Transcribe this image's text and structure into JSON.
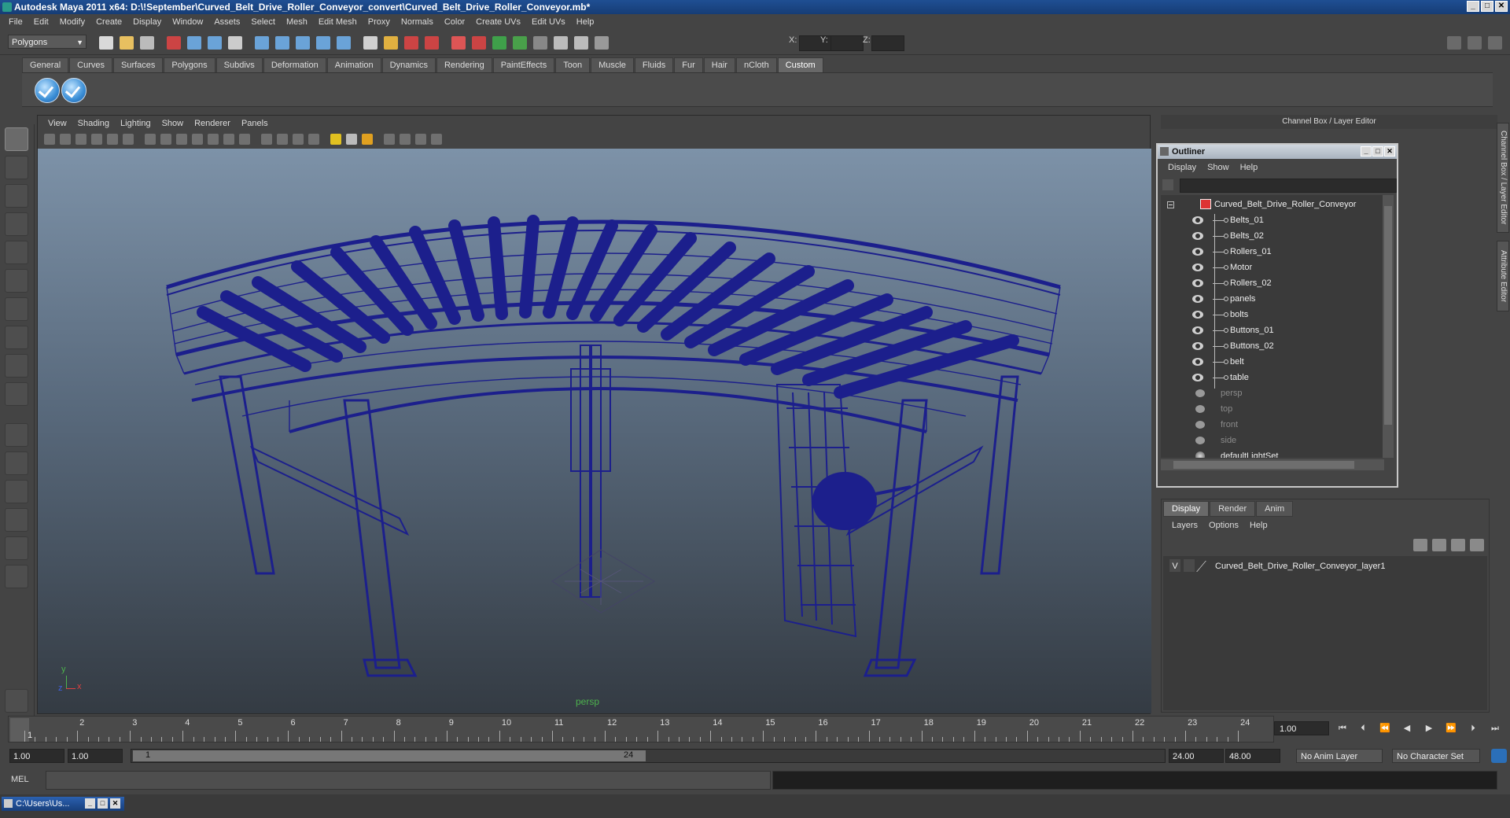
{
  "window": {
    "title": "Autodesk Maya 2011 x64: D:\\!September\\Curved_Belt_Drive_Roller_Conveyor_convert\\Curved_Belt_Drive_Roller_Conveyor.mb*",
    "minimize": "_",
    "maximize": "□",
    "close": "✕"
  },
  "menubar": [
    "File",
    "Edit",
    "Modify",
    "Create",
    "Display",
    "Window",
    "Assets",
    "Select",
    "Mesh",
    "Edit Mesh",
    "Proxy",
    "Normals",
    "Color",
    "Create UVs",
    "Edit UVs",
    "Help"
  ],
  "statusline": {
    "mode": "Polygons",
    "x_label": "X:",
    "y_label": "Y:",
    "z_label": "Z:"
  },
  "shelf_tabs": [
    "General",
    "Curves",
    "Surfaces",
    "Polygons",
    "Subdivs",
    "Deformation",
    "Animation",
    "Dynamics",
    "Rendering",
    "PaintEffects",
    "Toon",
    "Muscle",
    "Fluids",
    "Fur",
    "Hair",
    "nCloth",
    "Custom"
  ],
  "shelf_active": "Custom",
  "viewport": {
    "menu": [
      "View",
      "Shading",
      "Lighting",
      "Show",
      "Renderer",
      "Panels"
    ],
    "camera_name": "persp",
    "axis_y": "y",
    "axis_x": "x",
    "axis_z": "z"
  },
  "channel_box_title": "Channel Box / Layer Editor",
  "side_tabs": [
    "Channel Box / Layer Editor",
    "Attribute Editor"
  ],
  "outliner": {
    "title": "Outliner",
    "menu": [
      "Display",
      "Show",
      "Help"
    ],
    "root": "Curved_Belt_Drive_Roller_Conveyor",
    "children": [
      "Belts_01",
      "Belts_02",
      "Rollers_01",
      "Motor",
      "Rollers_02",
      "panels",
      "bolts",
      "Buttons_01",
      "Buttons_02",
      "belt",
      "table"
    ],
    "cameras": [
      "persp",
      "top",
      "front",
      "side"
    ],
    "sets": [
      "defaultLightSet"
    ]
  },
  "layer_editor": {
    "tabs": [
      "Display",
      "Render",
      "Anim"
    ],
    "active_tab": "Display",
    "menu": [
      "Layers",
      "Options",
      "Help"
    ],
    "layer_visible": "V",
    "layer_name": "Curved_Belt_Drive_Roller_Conveyor_layer1"
  },
  "timeline": {
    "ticks": [
      "1",
      "2",
      "3",
      "4",
      "5",
      "6",
      "7",
      "8",
      "9",
      "10",
      "11",
      "12",
      "13",
      "14",
      "15",
      "16",
      "17",
      "18",
      "19",
      "20",
      "21",
      "22",
      "23",
      "24"
    ],
    "current": "1",
    "current_field": "1.00"
  },
  "range": {
    "start": "1.00",
    "anim_start": "1.00",
    "slider_start": "1",
    "slider_end": "24",
    "anim_end": "24.00",
    "end": "48.00",
    "anim_layer": "No Anim Layer",
    "char_set": "No Character Set"
  },
  "cmdline": {
    "label": "MEL"
  },
  "taskbar": {
    "item": "C:\\Users\\Us..."
  }
}
